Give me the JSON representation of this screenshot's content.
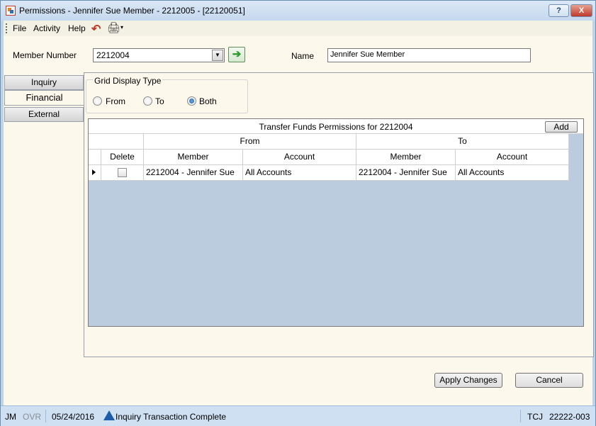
{
  "window": {
    "title": "Permissions - Jennifer Sue Member - 2212005 - [22120051]",
    "help_label": "?",
    "close_label": "X"
  },
  "menu": {
    "items": [
      "File",
      "Activity",
      "Help"
    ],
    "undo_icon": "↶",
    "print_icon": "🖨",
    "print_caret": "▾"
  },
  "member": {
    "label": "Member Number",
    "value": "2212004",
    "dropdown_glyph": "▼",
    "go_glyph": "➔"
  },
  "name": {
    "label": "Name",
    "value": "Jennifer Sue Member"
  },
  "tabs": [
    {
      "label": "Inquiry",
      "active": false
    },
    {
      "label": "Financial",
      "active": true
    },
    {
      "label": "External",
      "active": false
    }
  ],
  "grid_display_type": {
    "label": "Grid Display Type",
    "options": [
      {
        "label": "From",
        "checked": false
      },
      {
        "label": "To",
        "checked": false
      },
      {
        "label": "Both",
        "checked": true
      }
    ]
  },
  "grid": {
    "title": "Transfer Funds Permissions for 2212004",
    "add_label": "Add",
    "group_from": "From",
    "group_to": "To",
    "columns": [
      "Delete",
      "Member",
      "Account",
      "Member",
      "Account"
    ],
    "rows": [
      {
        "delete": false,
        "from_member": "2212004 - Jennifer Sue",
        "from_account": "All Accounts",
        "to_member": "2212004 - Jennifer Sue",
        "to_account": "All Accounts"
      }
    ]
  },
  "buttons": {
    "apply": "Apply Changes",
    "cancel": "Cancel"
  },
  "status": {
    "user": "JM",
    "mode": "OVR",
    "date": "05/24/2016",
    "message": "Inquiry Transaction Complete",
    "location": "TCJ",
    "terminal": "22222-003"
  }
}
